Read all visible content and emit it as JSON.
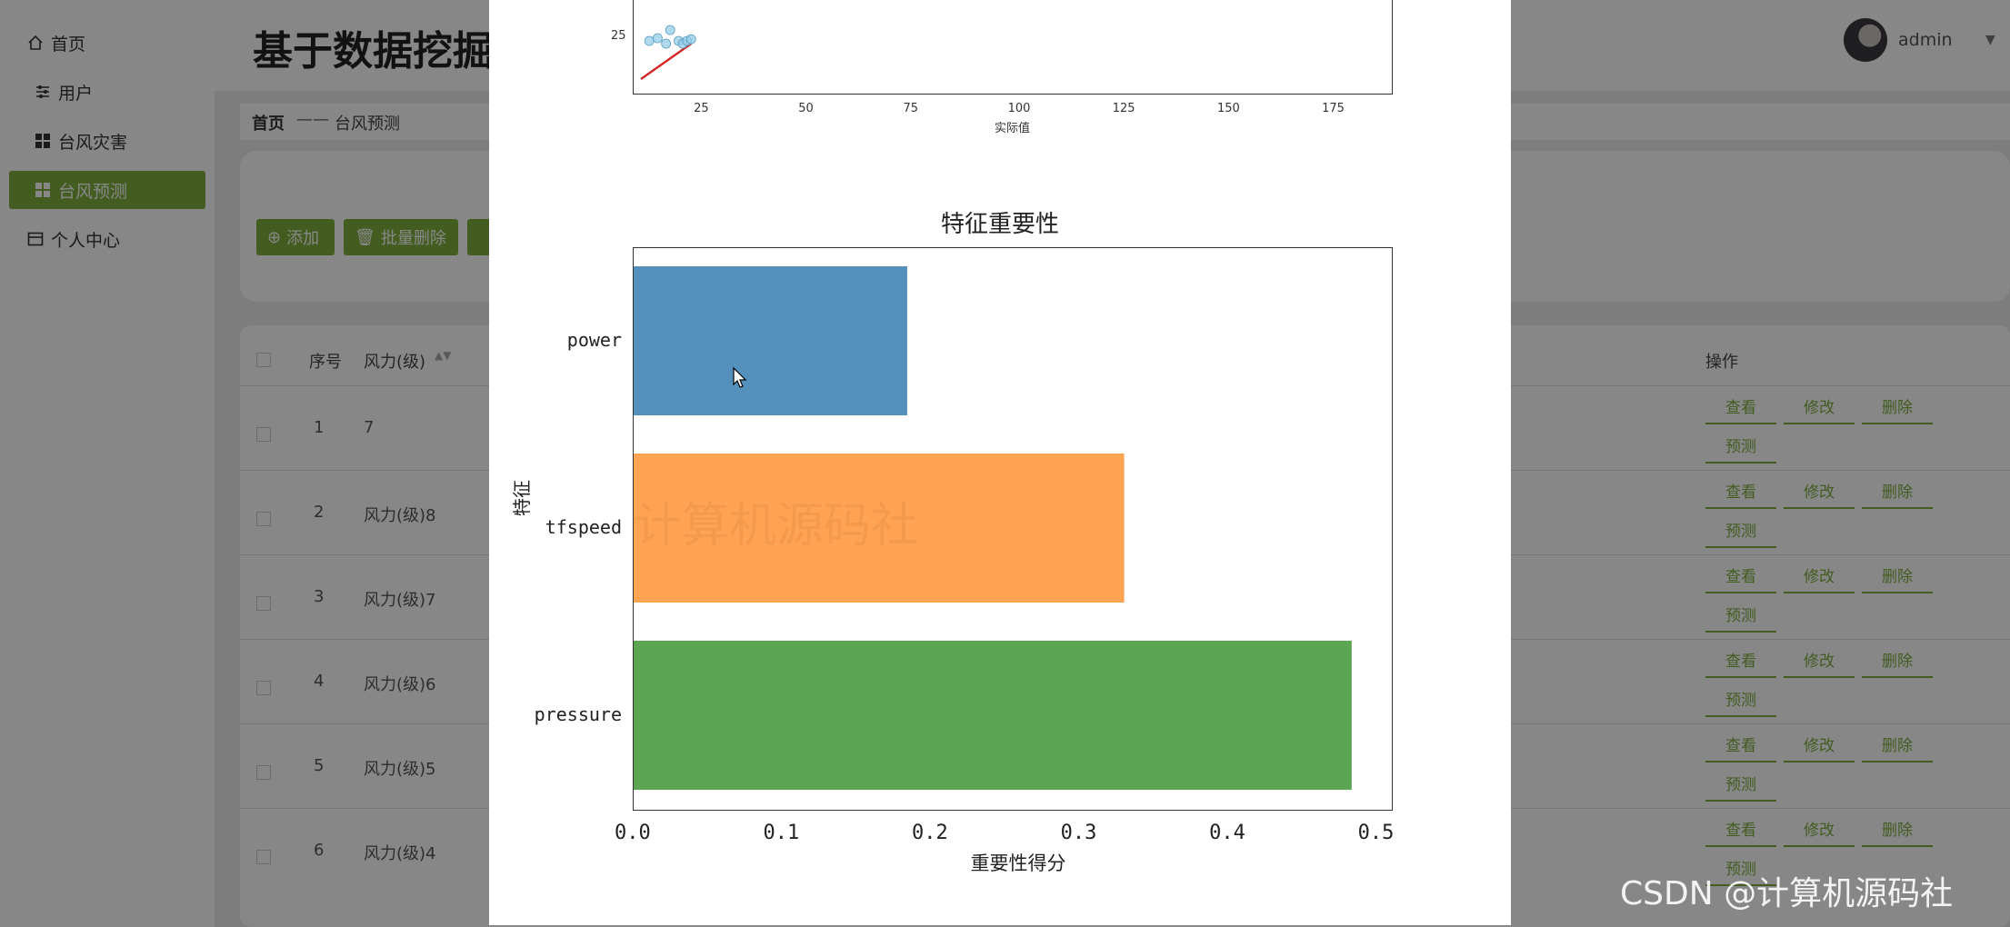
{
  "sidebar": {
    "items": [
      {
        "label": "首页",
        "icon": "home-icon"
      },
      {
        "label": "用户",
        "icon": "sliders-icon"
      },
      {
        "label": "台风灾害",
        "icon": "grid-icon"
      },
      {
        "label": "台风预测",
        "icon": "grid-icon",
        "active": true
      },
      {
        "label": "个人中心",
        "icon": "window-icon"
      }
    ]
  },
  "header": {
    "title": "基于数据挖掘",
    "user": "admin"
  },
  "breadcrumb": {
    "home": "首页",
    "separator": "——",
    "current": "台风预测"
  },
  "toolbar": {
    "add_label": "添加",
    "batch_delete_label": "批量删除"
  },
  "table": {
    "headers": {
      "index": "序号",
      "power": "风力(级)",
      "ops": "操作"
    },
    "rows": [
      {
        "index": "1",
        "power": "7"
      },
      {
        "index": "2",
        "power": "风力(级)8"
      },
      {
        "index": "3",
        "power": "风力(级)7"
      },
      {
        "index": "4",
        "power": "风力(级)6"
      },
      {
        "index": "5",
        "power": "风力(级)5"
      },
      {
        "index": "6",
        "power": "风力(级)4"
      }
    ],
    "ops": {
      "view": "查看",
      "edit": "修改",
      "delete": "删除",
      "predict": "预测"
    }
  },
  "colors": {
    "accent": "#7fae3e",
    "bar1": "#4a8ab8",
    "bar2": "#ff9f4a",
    "bar3": "#52a04a",
    "fit_line": "#d62728",
    "scatter": "#8ec9e6"
  },
  "chart_data": [
    {
      "type": "scatter",
      "xlabel": "实际值",
      "ylabel": "",
      "xticks": [
        25,
        50,
        75,
        100,
        125,
        150,
        175
      ],
      "yticks": [
        25
      ],
      "points": [
        {
          "x": 12,
          "y": 24
        },
        {
          "x": 14,
          "y": 24.5
        },
        {
          "x": 16,
          "y": 23.5
        },
        {
          "x": 17,
          "y": 26
        },
        {
          "x": 19,
          "y": 24
        },
        {
          "x": 20,
          "y": 23.5
        },
        {
          "x": 21,
          "y": 24
        },
        {
          "x": 22,
          "y": 24.3
        }
      ],
      "fit_line": [
        {
          "x": 10,
          "y": 17
        },
        {
          "x": 22,
          "y": 23.5
        }
      ]
    },
    {
      "type": "bar",
      "orientation": "horizontal",
      "title": "特征重要性",
      "xlabel": "重要性得分",
      "ylabel": "特征",
      "xlim": [
        0,
        0.51
      ],
      "xticks": [
        "0.0",
        "0.1",
        "0.2",
        "0.3",
        "0.4",
        "0.5"
      ],
      "categories": [
        "power",
        "tfspeed",
        "pressure"
      ],
      "values": [
        0.184,
        0.33,
        0.483
      ]
    }
  ],
  "watermark": "CSDN @计算机源码社",
  "image_watermark": "计算机源码社"
}
